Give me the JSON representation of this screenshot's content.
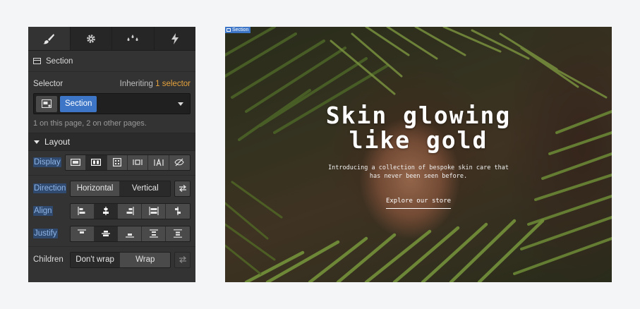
{
  "panel": {
    "tabs": [
      {
        "icon": "paintbrush-icon"
      },
      {
        "icon": "gear-icon"
      },
      {
        "icon": "drops-icon"
      },
      {
        "icon": "lightning-icon"
      }
    ],
    "element_title": "Section",
    "selector_label": "Selector",
    "inheriting_prefix": "Inheriting",
    "inheriting_count": "1 selector",
    "selector_chip": "Section",
    "usage_note": "1 on this page, 2 on other pages.",
    "layout_title": "Layout",
    "display_label": "Display",
    "direction_label": "Direction",
    "direction_options": [
      "Horizontal",
      "Vertical"
    ],
    "align_label": "Align",
    "justify_label": "Justify",
    "children_label": "Children",
    "children_options": [
      "Don't wrap",
      "Wrap"
    ]
  },
  "preview": {
    "tag": "Section",
    "headline_line1": "Skin glowing",
    "headline_line2": "like gold",
    "body_line1": "Introducing a collection of bespoke skin care that",
    "body_line2": "has never been seen before.",
    "cta": "Explore our store"
  },
  "colors": {
    "panel_bg": "#333333",
    "accent_blue": "#3d76c7",
    "inherit_orange": "#e6a23c"
  }
}
